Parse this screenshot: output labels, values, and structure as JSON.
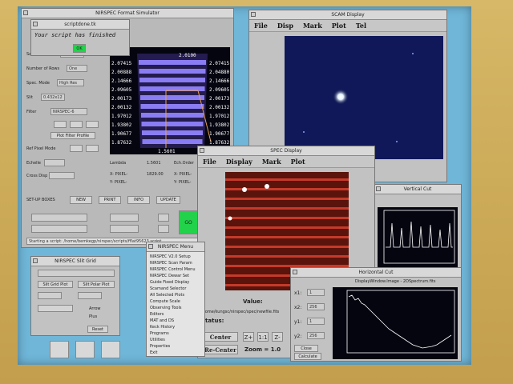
{
  "nirspec": {
    "title": "NIRSPEC Format Simulator",
    "labels": [
      "Sad Pattern",
      "Number of Rows",
      "Spec. Mode",
      "Slit",
      "Filter",
      "Ref Pixel Mode",
      "Echelle",
      "Cross Disp",
      "Lambda",
      "X- PIXEL-",
      "Y- PIXEL-",
      "Ech.Order",
      "X- PIXEL-",
      "Y- PIXEL-"
    ],
    "values": [
      "Use",
      "One",
      "High Res",
      "0.432x12",
      "NIRSPEC-6",
      "",
      "",
      "",
      "1.5601",
      "1829.00",
      "",
      "",
      "",
      ""
    ],
    "buttons": [
      "Plot Filter Profile",
      "NEW",
      "PRINT",
      "INFO",
      "UPDATE"
    ],
    "run_label": "GO",
    "status_line": "Starting a script: /home/bemkegp/nirspec/scripts/fflat95623.script",
    "plot_top_label": "2.0100",
    "plot_bottom_label": "1.5601",
    "left_wavelengths": [
      "2.07415",
      "2.00888",
      "2.14666",
      "2.09605",
      "2.00173",
      "2.00132",
      "1.97012",
      "1.93802",
      "1.90677",
      "1.87632"
    ],
    "right_wavelengths": [
      "2.07415",
      "2.04880",
      "2.14666",
      "2.09605",
      "2.00173",
      "2.00132",
      "1.97012",
      "1.93802",
      "1.90677",
      "1.87632"
    ]
  },
  "popup": {
    "title": "scriptdone.tk",
    "message": "Your script has finished",
    "ok_label": "OK"
  },
  "scam": {
    "title": "SCAM Display",
    "menu": [
      "File",
      "Disp",
      "Mark",
      "Plot",
      "Tel"
    ]
  },
  "spec": {
    "title": "SPEC Display",
    "menu": [
      "File",
      "Display",
      "Mark",
      "Plot"
    ],
    "value_label": "Value:",
    "status_label": "Status:",
    "path": "/home/kungsc/nirspec/spec/newfile.fits",
    "center_label": "Center",
    "recenter_label": "Re-Center",
    "zoom_label": "Zoom = 1.0",
    "zoom_buttons": [
      "Z+",
      "1:1",
      "Z-"
    ]
  },
  "vertical_cut": {
    "title": "Vertical Cut"
  },
  "horizontal_cut": {
    "title": "Horizontal Cut",
    "header": "DisplayWindow.Image - 2DSpectrum.fits",
    "labels": [
      "x1:",
      "x2:",
      "y1:",
      "y2:"
    ],
    "values": [
      "1",
      "256",
      "1",
      "256"
    ],
    "buttons": [
      "Close",
      "Calculate"
    ]
  },
  "slit": {
    "title": "NIRSPEC Slit Grid",
    "buttons": [
      "Slit Grid Plot",
      "Slit Polar Plot"
    ],
    "radio": [
      "Arrow",
      "Plus"
    ],
    "reset_label": "Reset"
  },
  "menu_win": {
    "title": "NIRSPEC Menu",
    "items": [
      "NIRSPEC V2.0 Setup",
      "NIRSPEC Scan Param",
      "NIRSPEC Control Menu",
      "NIRSPEC Dewar Set",
      "Guide Fixed Display",
      "Scamand Selector",
      "All Selected Plots",
      "Compute Scale",
      "Observing Tools",
      "Editors",
      "MAT and DS",
      "Keck History",
      "Programs",
      "Utilities",
      "Properties",
      "Exit"
    ]
  },
  "desktop_icons": [
    "icon1",
    "icon2",
    "icon3"
  ],
  "colors": {
    "bezel": "#c9a95a",
    "desktop": "#6fb6d8",
    "ok_green": "#22d24a",
    "plot_purple": "#8a7cf2",
    "spectrum_red": "#c43a2a"
  }
}
